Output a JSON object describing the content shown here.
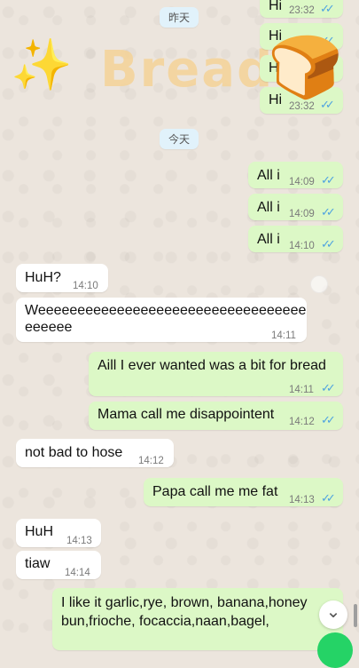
{
  "dates": {
    "yesterday": "昨天",
    "today": "今天"
  },
  "banner": {
    "sparkle": "✨",
    "text": "Bread",
    "bread_emoji": "🍞"
  },
  "messages": [
    {
      "dir": "out",
      "text": "Hi",
      "time": "23:32",
      "read": true
    },
    {
      "dir": "out",
      "text": "Hi",
      "time": "23:32",
      "read": true
    },
    {
      "dir": "out",
      "text": "Hi",
      "time": "23:32",
      "read": true
    },
    {
      "dir": "out",
      "text": "Hi",
      "time": "23:32",
      "read": true
    },
    {
      "dir": "out",
      "text": "All i",
      "time": "14:09",
      "read": true
    },
    {
      "dir": "out",
      "text": "All i",
      "time": "14:09",
      "read": true
    },
    {
      "dir": "out",
      "text": "All i",
      "time": "14:10",
      "read": true
    },
    {
      "dir": "in",
      "text": "HuH?",
      "time": "14:10"
    },
    {
      "dir": "in",
      "text_line1": "Weeeeeeeeeeeeeeeeeeeeeeeeeeeeeeeeee",
      "text_line2": "eeeeee",
      "time": "14:11"
    },
    {
      "dir": "out",
      "text": "Aill I ever wanted was a bit for bread",
      "time": "14:11",
      "read": true
    },
    {
      "dir": "out",
      "text": "Mama call me disappointent",
      "time": "14:12",
      "read": true
    },
    {
      "dir": "in",
      "text": "not bad to hose",
      "time": "14:12"
    },
    {
      "dir": "out",
      "text": "Papa call me me fat",
      "time": "14:13",
      "read": true
    },
    {
      "dir": "in",
      "text": "HuH",
      "time": "14:13"
    },
    {
      "dir": "in",
      "text": "tiaw",
      "time": "14:14"
    },
    {
      "dir": "out",
      "text_line1": "I like it garlic,rye, brown, banana,honey",
      "text_line2": "bun,frioche, focaccia,naan,bagel,"
    }
  ],
  "read_ticks": "✓✓",
  "scroll_down_glyph": "⌄",
  "colors": {
    "outgoing": "#dcf8c6",
    "incoming": "#ffffff",
    "tick": "#4fa3e0",
    "fab": "#25d366"
  }
}
